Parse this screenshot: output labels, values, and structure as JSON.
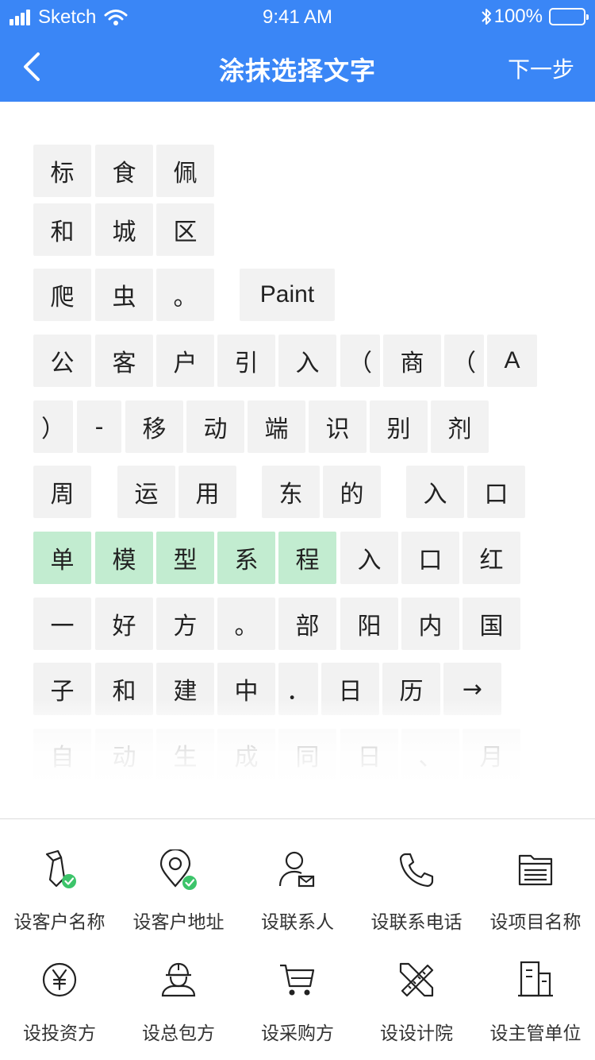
{
  "status_bar": {
    "carrier": "Sketch",
    "time": "9:41 AM",
    "battery": "100%"
  },
  "nav": {
    "title": "涂抹选择文字",
    "next_label": "下一步"
  },
  "char_rows": [
    [
      "标",
      "食",
      "佩"
    ],
    [
      "和",
      "城",
      "区"
    ],
    [
      "爬",
      "虫",
      "。",
      "Paint"
    ],
    [
      "公",
      "客",
      "户",
      "引",
      "入",
      "（",
      "商",
      "（",
      "A"
    ],
    [
      "）",
      "-",
      "移",
      "动",
      "端",
      "识",
      "别",
      "剂"
    ],
    [
      "周",
      "运",
      "用",
      "东",
      "的",
      "入",
      "口"
    ],
    [
      "单",
      "模",
      "型",
      "系",
      "程",
      "入",
      "口",
      "红"
    ],
    [
      "一",
      "好",
      "方",
      "。",
      "部",
      "阳",
      "内",
      "国"
    ],
    [
      "子",
      "和",
      "建",
      "中",
      "．",
      "日",
      "历",
      "→"
    ],
    [
      "自",
      "动",
      "生",
      "成",
      "同",
      "日",
      "、",
      "月"
    ]
  ],
  "selected_text": "单模型系程",
  "tools": [
    {
      "label": "设客户名称",
      "icon": "tie-icon",
      "checked": true
    },
    {
      "label": "设客户地址",
      "icon": "location-icon",
      "checked": true
    },
    {
      "label": "设联系人",
      "icon": "contact-person-icon",
      "checked": false
    },
    {
      "label": "设联系电话",
      "icon": "phone-icon",
      "checked": false
    },
    {
      "label": "设项目名称",
      "icon": "folder-list-icon",
      "checked": false
    },
    {
      "label": "设投资方",
      "icon": "yen-icon",
      "checked": false
    },
    {
      "label": "设总包方",
      "icon": "worker-helmet-icon",
      "checked": false
    },
    {
      "label": "设采购方",
      "icon": "cart-icon",
      "checked": false
    },
    {
      "label": "设设计院",
      "icon": "ruler-pencil-icon",
      "checked": false
    },
    {
      "label": "设主管单位",
      "icon": "building-icon",
      "checked": false
    }
  ],
  "colors": {
    "header": "#3a86f6",
    "cell": "#f2f2f2",
    "selected_cell": "#c2ecd0",
    "check": "#3cc46a"
  }
}
